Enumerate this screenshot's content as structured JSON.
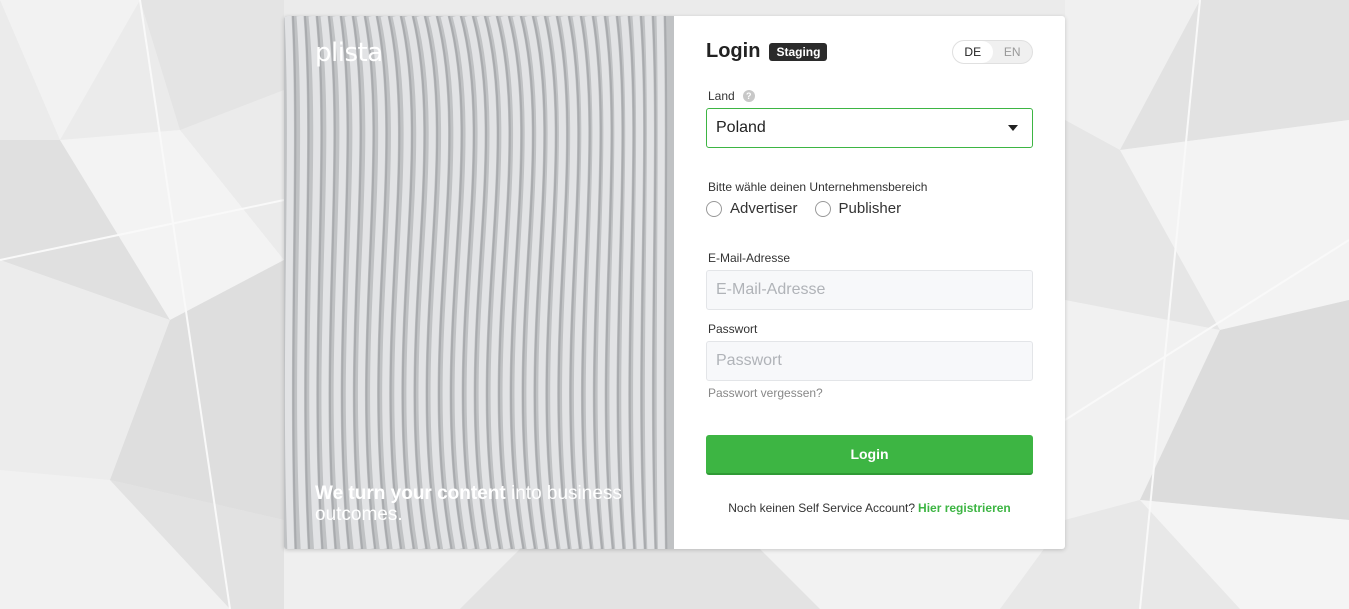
{
  "brand": {
    "logo_text": "plista",
    "tagline_bold": "We turn your content",
    "tagline_rest": " into business outcomes."
  },
  "header": {
    "title": "Login",
    "env_badge": "Staging",
    "languages": [
      {
        "code": "DE",
        "active": true
      },
      {
        "code": "EN",
        "active": false
      }
    ]
  },
  "country": {
    "label": "Land",
    "help_icon": "question-icon",
    "selected": "Poland"
  },
  "business_area": {
    "label": "Bitte wähle deinen Unternehmensbereich",
    "options": [
      "Advertiser",
      "Publisher"
    ]
  },
  "email": {
    "label": "E-Mail-Adresse",
    "placeholder": "E-Mail-Adresse",
    "value": ""
  },
  "password": {
    "label": "Passwort",
    "placeholder": "Passwort",
    "value": "",
    "forgot_label": "Passwort vergessen?"
  },
  "actions": {
    "login_label": "Login"
  },
  "register": {
    "prompt": "Noch keinen Self Service Account?",
    "link_label": "Hier registrieren"
  },
  "colors": {
    "accent": "#3db543",
    "badge_bg": "#2b2b2b"
  }
}
